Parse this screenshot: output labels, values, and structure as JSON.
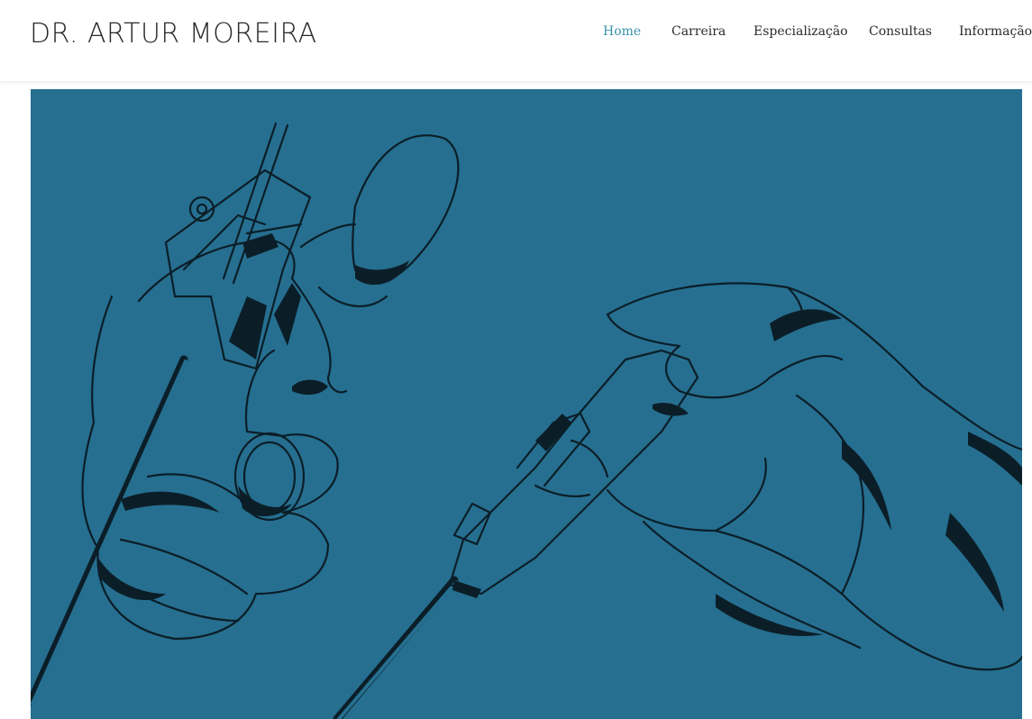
{
  "site": {
    "logo_text": "DR. ARTUR MOREIRA"
  },
  "nav": {
    "items": [
      {
        "label": "Home",
        "active": true
      },
      {
        "label": "Carreira",
        "active": false
      },
      {
        "label": "Especialização",
        "active": false
      },
      {
        "label": "Consultas",
        "active": false
      },
      {
        "label": "Informação",
        "active": false
      }
    ]
  },
  "colors": {
    "accent": "#3a92ac",
    "hero_background": "#266f90",
    "line_art": "#0b1e28",
    "text": "#2b2b2b"
  }
}
